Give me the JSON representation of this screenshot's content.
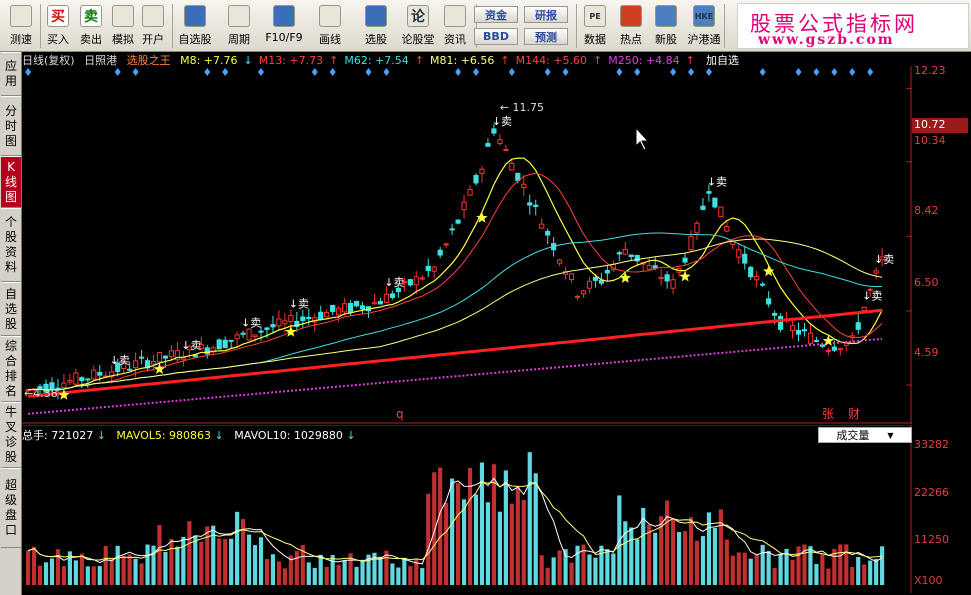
{
  "toolbar": {
    "buttons": [
      {
        "label": "测速",
        "icon": "speed-clock-icon"
      },
      {
        "label": "买入",
        "icon": "buy-icon",
        "glyph": "买",
        "color": "#d01010"
      },
      {
        "label": "卖出",
        "icon": "sell-icon",
        "glyph": "卖",
        "color": "#108010"
      },
      {
        "label": "模拟",
        "icon": "hammer-icon"
      },
      {
        "label": "开户",
        "icon": "lock-icon"
      },
      {
        "label": "自选股",
        "icon": "favorites-icon"
      },
      {
        "label": "周期",
        "icon": "period-clock-icon"
      },
      {
        "label": "F10/F9",
        "icon": "f10-icon"
      },
      {
        "label": "画线",
        "icon": "pencil-icon"
      },
      {
        "label": "选股",
        "icon": "stock-picker-icon"
      },
      {
        "label": "论股堂",
        "icon": "forum-icon",
        "glyph": "论"
      },
      {
        "label": "资讯",
        "icon": "news-icon"
      },
      {
        "label": "数据",
        "icon": "pe-data-icon",
        "glyph": "PE"
      },
      {
        "label": "热点",
        "icon": "hot-icon"
      },
      {
        "label": "新股",
        "icon": "new-stock-icon"
      },
      {
        "label": "沪港通",
        "icon": "hk-connect-icon",
        "glyph": "HKE"
      }
    ],
    "small_buttons": [
      "资金",
      "BBD",
      "研报",
      "预测"
    ]
  },
  "banner": {
    "line1": "股票公式指标网",
    "line2": "www.gszb.com"
  },
  "left_tabs": [
    {
      "label": "应用",
      "active": false
    },
    {
      "label": "分时图",
      "active": false
    },
    {
      "label": "K线图",
      "active": true
    },
    {
      "label": "个股资料",
      "active": false
    },
    {
      "label": "自选股",
      "active": false
    },
    {
      "label": "综合排名",
      "active": false
    },
    {
      "label": "牛叉诊股",
      "active": false
    },
    {
      "label": "超级盘口",
      "active": false
    }
  ],
  "info_line": {
    "period": "日线(复权)",
    "stock_name": "日照港",
    "indicator_name": "选股之王",
    "mas": [
      {
        "text": "M8: +7.76",
        "arrow": "↓",
        "color": "#ffff40"
      },
      {
        "text": "M13: +7.73",
        "arrow": "↑",
        "color": "#ff4040"
      },
      {
        "text": "M62: +7.54",
        "arrow": "↑",
        "color": "#40e0e0"
      },
      {
        "text": "M81: +6.56",
        "arrow": "↑",
        "color": "#ffff80"
      },
      {
        "text": "M144: +5.60",
        "arrow": "↑",
        "color": "#ff4040"
      },
      {
        "text": "M250: +4.84",
        "arrow": "↑",
        "color": "#e040e0"
      }
    ],
    "right_text": "加自选"
  },
  "price_axis": {
    "ticks": [
      "12.23",
      "10.34",
      "8.42",
      "6.50",
      "4.59"
    ],
    "current_price": "10.72"
  },
  "annotations": {
    "high_price": "11.75",
    "low_price": "4.38",
    "sell_label": "卖",
    "bottom_marks": [
      "q",
      "张",
      "财"
    ]
  },
  "volume": {
    "total_label": "总手: 721027",
    "total_arrow": "↓",
    "ma5_label": "MAVOL5: 980863",
    "ma5_arrow": "↓",
    "ma10_label": "MAVOL10: 1029880",
    "ma10_arrow": "↓",
    "selector": "成交量",
    "ticks": [
      "33282",
      "22266",
      "11250",
      "X100"
    ]
  },
  "colors": {
    "up": "#ff3030",
    "down": "#40e0e0",
    "ma8": "#ffff40",
    "ma13": "#ff4040",
    "ma62": "#40e0e0",
    "ma81": "#ffff80",
    "ma144": "#ff2020",
    "ma250": "#e040e0",
    "signal": "#4aa0ff"
  }
}
